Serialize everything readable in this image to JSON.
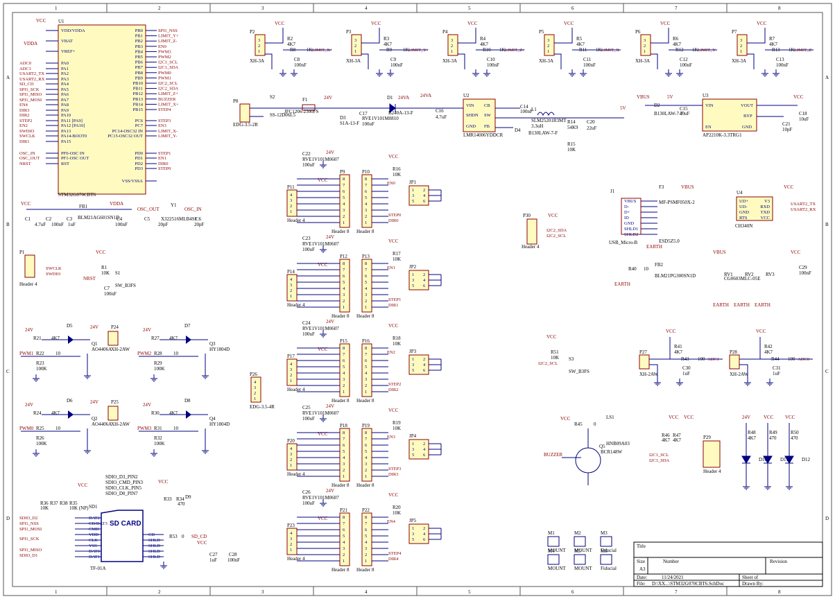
{
  "sheet": {
    "column_numbers": [
      "1",
      "2",
      "3",
      "4",
      "5",
      "6",
      "7",
      "8"
    ],
    "row_letters": [
      "A",
      "B",
      "C",
      "D"
    ]
  },
  "title_block": {
    "title_label": "Title",
    "size_label": "Size",
    "size_value": "A3",
    "number_label": "Number",
    "revision_label": "Revision",
    "date_label": "Date:",
    "date_value": "11/24/2021",
    "sheet_label": "Sheet   of",
    "file_label": "File:",
    "file_value": "D:\\XX...\\STM32G070CBT6.SchDoc",
    "drawn_label": "Drawn By:"
  },
  "mcu": {
    "ref": "U1",
    "part": "STM32G070CBT6",
    "left_pins": [
      "VDD/VDDA",
      "VBAT",
      "VREF+",
      "PA0",
      "PA1",
      "PA2",
      "PA3",
      "PA4",
      "PA5",
      "PA6",
      "PA7",
      "PA8",
      "PA9",
      "PA10",
      "PA11 [PA9]",
      "PA12 [PA10]",
      "PA13",
      "PA14-BOOT0",
      "PA15",
      "PF0-OSC IN",
      "PF1-OSC OUT",
      "RST"
    ],
    "right_pins": [
      "PB0",
      "PB1",
      "PB2",
      "PB3",
      "PB4",
      "PB5",
      "PB6",
      "PB7",
      "PB8",
      "PB9",
      "PB10",
      "PB11",
      "PB12",
      "PB13",
      "PB14",
      "PB15",
      "PC6",
      "PC7",
      "PC14-OSC32 IN",
      "PC15-OSC32 OUT",
      "PD0",
      "PD1",
      "PD2",
      "PD3",
      "VSS/VSSA"
    ],
    "left_nets": [
      "ADC0",
      "ADC1",
      "USART2_TX",
      "USART2_RX",
      "SD_CD",
      "SPI1_SCK",
      "SPI1_MISO",
      "SPI1_MOSI",
      "EN4",
      "DIR3",
      "DIR2",
      "STEP2",
      "EN2",
      "SWDIO",
      "SWCLK",
      "DIR1",
      "OSC_IN",
      "OSC_OUT",
      "NRST"
    ],
    "right_nets": [
      "SPI1_NSS",
      "LIMIT_Y+",
      "LIMIT_Z-",
      "EN0",
      "PWM3",
      "PWM2",
      "I2C1_SCL",
      "I2C1_SDA",
      "PWM0",
      "PWM1",
      "I2C2_SCL",
      "I2C2_SDA",
      "LIMIT_Z+",
      "BUZZER",
      "LIMIT_X+",
      "STEP4",
      "STEP3",
      "EN3",
      "LIMIT_X-",
      "LIMIT_Y-",
      "STEP1",
      "EN1",
      "DIR0",
      "STEP0"
    ]
  },
  "limit_connectors": [
    {
      "ref": "P2",
      "part": "XH-3A",
      "res": "R2",
      "cap": "C8",
      "net": "LIMIT_X+",
      "rser": "R8"
    },
    {
      "ref": "P3",
      "part": "XH-3A",
      "res": "R3",
      "cap": "C9",
      "net": "LIMIT_Y+",
      "rser": "R9"
    },
    {
      "ref": "P4",
      "part": "XH-3A",
      "res": "R4",
      "cap": "C10",
      "net": "LIMIT_Z+",
      "rser": "R10"
    },
    {
      "ref": "P5",
      "part": "XH-3A",
      "res": "R5",
      "cap": "C11",
      "net": "LIMIT_X-",
      "rser": "R11"
    },
    {
      "ref": "P6",
      "part": "XH-3A",
      "res": "R6",
      "cap": "C12",
      "net": "LIMIT_Y-",
      "rser": "R12"
    },
    {
      "ref": "P7",
      "part": "XH-3A",
      "res": "R7",
      "cap": "C13",
      "net": "LIMIT_Z-",
      "rser": "R13"
    }
  ],
  "common": {
    "vcc": "VCC",
    "vdda": "VDDA",
    "v24": "24V",
    "v24a": "24VA",
    "v5": "5V",
    "vbus": "VBUS",
    "r4k7": "4K7",
    "r1k": "1K",
    "c100n": "100nF",
    "earth": "EARTH"
  },
  "power": {
    "p8": "P8",
    "p8_part": "EDG-3.5-2R",
    "s2": "S2",
    "s2_part": "SS-12D06L5",
    "f1": "F1",
    "f1_part": "JFC1206-2300FS",
    "d1": "D1",
    "d1_part": "B240A-13-F",
    "d3": "D3",
    "d3_part": "S1A-13-F",
    "c17": "C17",
    "c17_part": "RVE1V101M0810",
    "c17_val": "100uF",
    "u2": "U2",
    "u2_part": "LMR14006YDDCR",
    "u2_pins": [
      "VIN",
      "SHDN",
      "GND",
      "CB",
      "SW",
      "FB"
    ],
    "c16": "C16",
    "c16_val": "4.7uF",
    "c14": "C14",
    "c14_val": "100nF",
    "l1": "L1",
    "l1_part": "SLM25201R3MT",
    "l1_val": "3.3uH",
    "d4": "D4",
    "d4_part": "B130LAW-7-F",
    "r14": "R14",
    "r14_val": "54K9",
    "r15": "R15",
    "r15_val": "10K",
    "c20": "C20",
    "c20_val": "22uF",
    "d2": "D2",
    "d2_part": "B130LAW-7-F",
    "c15": "C15",
    "c15_val": "10uF",
    "u3": "U3",
    "u3_part": "AP2210K-3.3TRG1",
    "u3_pins": [
      "VIN",
      "EN",
      "VOUT",
      "BYP",
      "GND"
    ],
    "c21": "C21",
    "c21_val": "10pF",
    "c18": "C18",
    "c18_val": "10uF"
  },
  "drivers": [
    {
      "cap": "C22",
      "capval": "RVE1V101M0607",
      "hdr": "P11",
      "p1": "P9",
      "p2": "P10",
      "r": "R16",
      "jp": "JP1",
      "step": "STEP0",
      "dir": "DIR0",
      "en": "EN0"
    },
    {
      "cap": "C23",
      "capval": "RVE1V101M0607",
      "hdr": "P14",
      "p1": "P12",
      "p2": "P13",
      "r": "R17",
      "jp": "JP2",
      "step": "STEP1",
      "dir": "DIR1",
      "en": "EN1"
    },
    {
      "cap": "C24",
      "capval": "RVE1V101M0607",
      "hdr": "P17",
      "p1": "P15",
      "p2": "P16",
      "r": "R18",
      "jp": "JP3",
      "step": "STEP2",
      "dir": "DIR2",
      "en": "EN2"
    },
    {
      "cap": "C25",
      "capval": "RVE1V101M0607",
      "hdr": "P20",
      "p1": "P18",
      "p2": "P19",
      "r": "R19",
      "jp": "JP4",
      "step": "STEP3",
      "dir": "DIR3",
      "en": "EN3"
    },
    {
      "cap": "C26",
      "capval": "RVE1V101M0607",
      "hdr": "P23",
      "p1": "P21",
      "p2": "P22",
      "r": "R20",
      "jp": "JP5",
      "step": "STEP4",
      "dir": "DIR4",
      "en": "EN4"
    }
  ],
  "driver_common": {
    "hdr_part": "Header 4",
    "p8_part": "Header 8",
    "jp_pins": [
      "1",
      "2",
      "3",
      "4",
      "5",
      "6"
    ],
    "r10k": "10K",
    "c100u": "100uF",
    "hdr8_pins": [
      "8",
      "7",
      "6",
      "5",
      "4",
      "3",
      "2",
      "1"
    ],
    "hdr4_pins": [
      "4",
      "3",
      "2",
      "1"
    ]
  },
  "osc": {
    "c1": "C1",
    "c1v": "4.7uF",
    "c2": "C2",
    "c2v": "100nF",
    "c3": "C3",
    "c3v": "1uF",
    "fb1": "FB1",
    "fb1p": "BLM21AG601SN1D",
    "c4": "C4",
    "c4v": "100nF",
    "osc_in": "OSC_IN",
    "osc_out": "OSC_OUT",
    "y1": "Y1",
    "y1p": "X322516MLB4SI",
    "c5": "C5",
    "c5v": "20pF",
    "c6": "C6",
    "c6v": "20pF"
  },
  "swd": {
    "ref": "P1",
    "part": "Header 4",
    "nets": [
      "SWCLK",
      "SWDIO"
    ]
  },
  "reset": {
    "r1": "R1",
    "r1v": "10K",
    "s1": "S1",
    "s1p": "SW_B3FS",
    "c7": "C7",
    "c7v": "100nF",
    "nrst": "NRST"
  },
  "i2c_hdr": {
    "ref": "P30",
    "part": "Header 4",
    "nets": [
      "I2C2_SDA",
      "I2C2_SCL"
    ]
  },
  "usb": {
    "j1": "J1",
    "j1p": "USB_Micro-B",
    "pins": [
      "VBUS",
      "D-",
      "D+",
      "ID",
      "GND",
      "SHLD1",
      "SHLD2"
    ],
    "f3": "F3",
    "f3p": "MF-PSMF050X-2",
    "d_esd": "ESD5Z5.0",
    "u4": "U4",
    "u4p": "CH340N",
    "u4_left": [
      "UD+",
      "UD-",
      "GND",
      "RTS"
    ],
    "u4_right": [
      "V3",
      "RXD",
      "TXD",
      "VCC"
    ],
    "nets": [
      "USART2_TX",
      "USART2_RX"
    ],
    "r40": "R40",
    "r40v": "10",
    "fb2": "FB2",
    "fb2p": "BLM21PG300SN1D",
    "rv": [
      "RV1",
      "RV2",
      "RV3"
    ],
    "rvp": "CG0603MLC-05E",
    "c29": "C29",
    "c29v": "100nF"
  },
  "pwm_outs": [
    {
      "d": "D5",
      "q": "Q1",
      "qp": "AO4406A",
      "p": "P24",
      "pp": "XH-2AW",
      "r1": "R21",
      "r2": "R22",
      "r2v": "10",
      "r3": "R23",
      "r3v": "100K",
      "net": "PWM1"
    },
    {
      "d": "D7",
      "q": "Q3",
      "qp": "HY1804D",
      "p": "",
      "pp": "",
      "r1": "R27",
      "r2": "R28",
      "r2v": "10",
      "r3": "R29",
      "r3v": "100K",
      "net": "PWM2"
    },
    {
      "d": "D6",
      "q": "Q2",
      "qp": "AO4406A",
      "p": "P25",
      "pp": "XH-2AW",
      "r1": "R24",
      "r2": "R25",
      "r2v": "10",
      "r3": "R26",
      "r3v": "100K",
      "net": "PWM0"
    },
    {
      "d": "D8",
      "q": "Q4",
      "qp": "HY1804D",
      "p": "",
      "pp": "",
      "r1": "R30",
      "r2": "R31",
      "r2v": "10",
      "r3": "R32",
      "r3v": "100K",
      "net": "PWM3"
    }
  ],
  "p26": {
    "ref": "P26",
    "part": "EDG-3.5-4R",
    "pins": [
      "4",
      "3",
      "2",
      "1"
    ]
  },
  "sd": {
    "notes": [
      "SDIO_D3_PIN2",
      "SDIO_CMD_PIN3",
      "SDIO_CLK_PIN5",
      "SDIO_D0_PIN7"
    ],
    "ref": "SD1",
    "title": "SD CARD",
    "part": "TF-01A",
    "pins": [
      "DAT2",
      "CD/DAT3",
      "CMD",
      "VDD",
      "CLK",
      "VSS",
      "DAT0",
      "DAT1"
    ],
    "shld": [
      "CD",
      "SHLD",
      "SHLD",
      "SHLD",
      "SHLD"
    ],
    "nets": [
      "SDIO_D2",
      "SPI1_NSS",
      "SPI1_MOSI",
      "SPI1_SCK",
      "SPI1_MISO",
      "SDIO_D1"
    ],
    "rs": [
      "R36",
      "R37",
      "R38",
      "R35"
    ],
    "rv": "10K",
    "rnp": "10K (NP)",
    "r53": "R53",
    "r53v": "0",
    "sdcd": "SD_CD",
    "r33": "R33",
    "r34": "R34",
    "r34v": "470",
    "d9": "D9",
    "c27": "C27",
    "c27v": "1uF",
    "c28": "C28",
    "c28v": "100nF"
  },
  "i2c_pull": {
    "r51": "R51",
    "r51v": "10K",
    "net": "I2C2_SCL",
    "s3": "S3",
    "s3p": "SW_B3FS"
  },
  "adc": [
    {
      "p": "P27",
      "pp": "XH-2AW",
      "r1": "R41",
      "r2": "R43",
      "r2v": "100",
      "c": "C30",
      "cv": "1uF",
      "net": "ADC1"
    },
    {
      "p": "P28",
      "pp": "XH-2AW",
      "r1": "R42",
      "r2": "R44",
      "r2v": "100",
      "c": "C31",
      "cv": "1uF",
      "net": "ADC0"
    }
  ],
  "buzzer": {
    "r": "R45",
    "rv": "0",
    "ls": "LS1",
    "lsp": "HNB09A03",
    "q": "Q5",
    "qp": "BCR148W",
    "net": "BUZZER"
  },
  "i2c1": {
    "r1": "R46",
    "r2": "R47",
    "p": "P29",
    "pp": "Header 4",
    "nets": [
      "I2C1_SCL",
      "I2C1_SDA"
    ]
  },
  "leds": [
    {
      "r": "R48",
      "rv": "4K7",
      "d": "D10",
      "rail": "24V"
    },
    {
      "r": "R49",
      "rv": "470",
      "d": "D11",
      "rail": "VCC"
    },
    {
      "r": "R50",
      "rv": "470",
      "d": "D12",
      "rail": "VCC"
    }
  ],
  "mounts": [
    {
      "ref": "M1",
      "label": "MOUNT"
    },
    {
      "ref": "M2",
      "label": "MOUNT"
    },
    {
      "ref": "M3",
      "label": "Fiducial"
    },
    {
      "ref": "M4",
      "label": "MOUNT"
    },
    {
      "ref": "M5",
      "label": "MOUNT"
    },
    {
      "ref": "M6",
      "label": "Fiducial"
    }
  ],
  "colors": {
    "wire": "#000080",
    "body": "#fffbc0",
    "outline": "#8b0000",
    "net": "#8b0000",
    "frame": "#555555"
  }
}
